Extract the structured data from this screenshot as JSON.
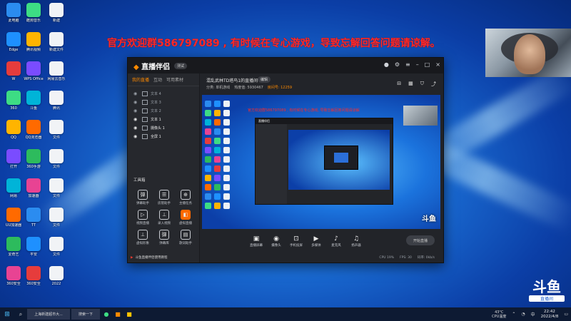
{
  "banner": "官方欢迎群586797089 , 有时候在专心游戏，导致忘解回答问题请谅解。",
  "desktop": {
    "col1": [
      "此电脑",
      "Edge",
      "W",
      "360",
      "QQ",
      "打开",
      "网易",
      "UU加速器",
      "爱奇艺",
      "360安全"
    ],
    "col2": [
      "酷狗音乐",
      "腾讯视频",
      "WPS Office",
      "斗鱼",
      "QQ浏览器",
      "360手游",
      "加速器",
      "TT",
      "平安",
      "360安全"
    ],
    "col3": [
      "新建",
      "新建文件",
      "网易云音乐",
      "腾讯",
      "文件",
      "文件",
      "文件",
      "文件",
      "文件",
      "2022"
    ]
  },
  "app": {
    "brand": "直播伴侣",
    "version": "测试",
    "sidebar_tabs": [
      "我的直播",
      "互动",
      "可用素材"
    ],
    "scenes": [
      "文本 4",
      "文本 3",
      "文本 2",
      "文本 1",
      "摄像头 1",
      "全屏 1"
    ],
    "toolbox_title": "工具箱",
    "tools": [
      {
        "icon": "弹",
        "label": "弹幕助手"
      },
      {
        "icon": "☰",
        "label": "房管助手"
      },
      {
        "icon": "⊕",
        "label": "主播任务"
      },
      {
        "icon": "▷",
        "label": "视频直播"
      },
      {
        "icon": "⊥",
        "label": "录入视频"
      },
      {
        "icon": "◧",
        "label": "虚拟直播"
      },
      {
        "icon": "⊥",
        "label": "虚拟形象"
      },
      {
        "icon": "弹",
        "label": "弹幕库"
      },
      {
        "icon": "▤",
        "label": "歌词助手"
      }
    ],
    "footer_text": "斗鱼直播伴侣使用教程",
    "room_title": "混乱武林TD塔鸟1的直播间",
    "room_tag": "编辑",
    "room_meta": [
      "房间号: 12259",
      "热度值: 5930467",
      "分类: 单机游戏"
    ],
    "controls": [
      {
        "icon": "▣",
        "label": "直播屏幕"
      },
      {
        "icon": "◉",
        "label": "摄像头"
      },
      {
        "icon": "⊡",
        "label": "手机投屏"
      },
      {
        "icon": "▶",
        "label": "多媒体"
      },
      {
        "icon": "♪",
        "label": "麦克风"
      },
      {
        "icon": "♫",
        "label": "扬声器"
      }
    ],
    "start_button": "开始直播",
    "stats": [
      "CPU 19%",
      "FPS: 30",
      "码率: 0kb/s"
    ]
  },
  "preview_banner": "官方欢迎群586797089 , 有时候在专心游戏, 导致忘解回答问题请谅解",
  "corner_logo": {
    "big": "斗鱼",
    "small": "直播间"
  },
  "taskbar": {
    "window_label": "上海新建超市大...",
    "search_label": "搜索一下",
    "weather_temp": "43°C",
    "weather_label": "CPU温度",
    "time": "22:42",
    "date": "2022/4/8",
    "tray_text": "中"
  }
}
